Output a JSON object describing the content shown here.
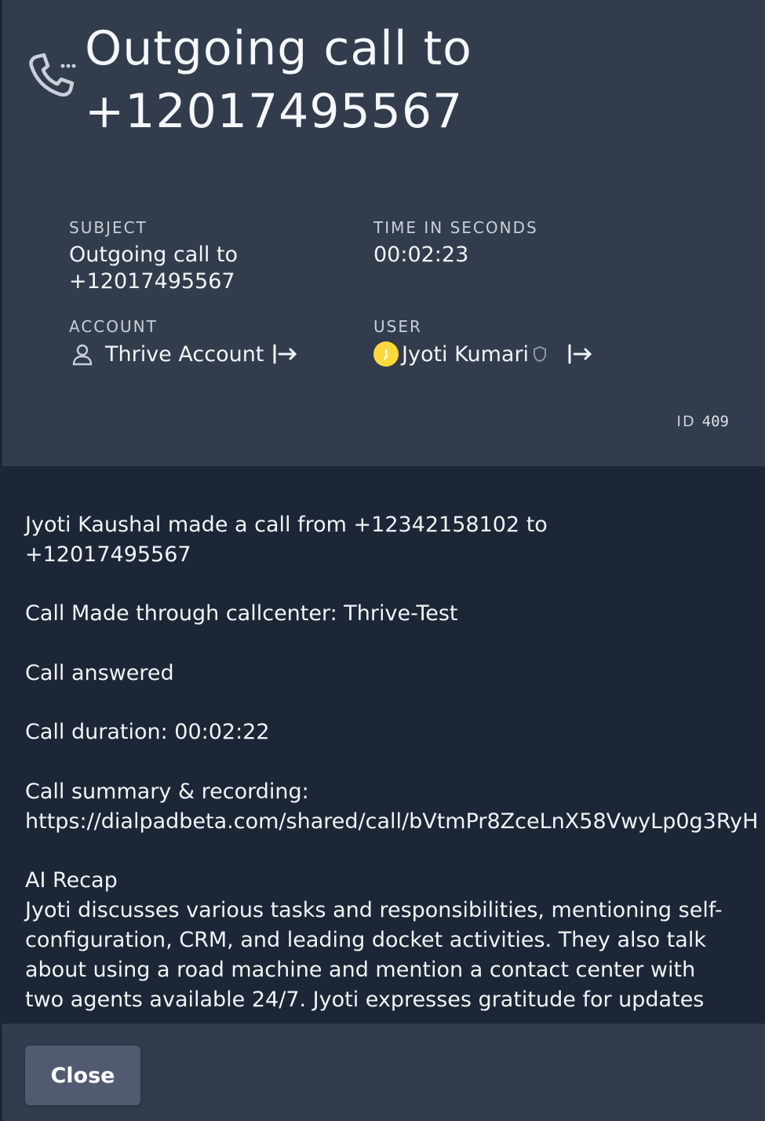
{
  "header": {
    "title_line1": "Outgoing call to",
    "title_line2": "+12017495567"
  },
  "fields": {
    "subject_label": "SUBJECT",
    "subject_value_line1": "Outgoing call to",
    "subject_value_line2": "+12017495567",
    "time_label": "TIME IN SECONDS",
    "time_value": "00:02:23",
    "account_label": "ACCOUNT",
    "account_value": "Thrive Account",
    "user_label": "USER",
    "user_initial": "J",
    "user_value": "Jyoti Kumari"
  },
  "id_label": "ID",
  "id_value": "409",
  "description": {
    "line1": "Jyoti Kaushal made a call from +12342158102 to",
    "line2": "+12017495567",
    "callcenter": "Call Made through callcenter: Thrive-Test",
    "answered": "Call answered",
    "duration": "Call duration: 00:02:22",
    "summary_label": "Call summary & recording:",
    "summary_link": "https://dialpadbeta.com/shared/call/bVtmPr8ZceLnX58VwyLp0g3RyH",
    "recap_label": "AI Recap",
    "recap_l1": "Jyoti discusses various tasks and responsibilities, mentioning self-",
    "recap_l2": "configuration, CRM, and leading docket activities. They also talk",
    "recap_l3": "about using a road machine and mention a contact center with",
    "recap_l4": "two agents available 24/7. Jyoti expresses gratitude for updates"
  },
  "footer": {
    "close_label": "Close"
  },
  "colors": {
    "header_bg": "#323c4c",
    "body_bg": "#1c2636",
    "avatar": "#ffd93b",
    "button_bg": "#525a72"
  },
  "icons": [
    "phone-dialing-icon",
    "person-icon",
    "goto-arrow-icon",
    "shield-icon"
  ]
}
